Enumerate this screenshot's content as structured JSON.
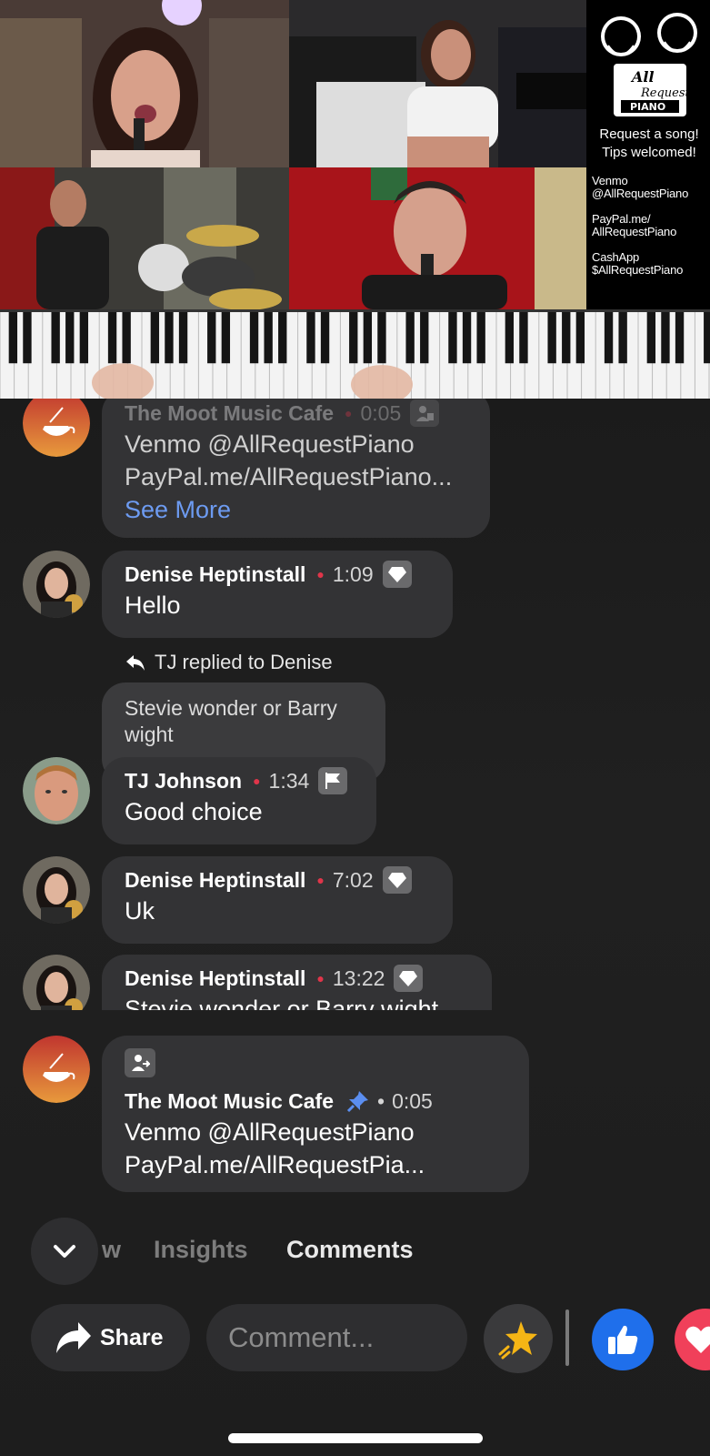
{
  "video": {
    "side_panel": {
      "logo_text": "All Request Piano",
      "line1": "Request a song!",
      "line2": "Tips welcomed!",
      "pay": [
        [
          "Venmo",
          "@AllRequestPiano"
        ],
        [
          "PayPal.me/",
          "AllRequestPiano"
        ],
        [
          "CashApp",
          "$AllRequestPiano"
        ]
      ]
    }
  },
  "comments": [
    {
      "author": "The Moot Music Cafe",
      "time": "0:05",
      "lines": [
        "Venmo @AllRequestPiano",
        "PayPal.me/AllRequestPiano..."
      ],
      "see_more": "See More",
      "badge": "moderator-icon"
    },
    {
      "author": "Denise Heptinstall",
      "time": "1:09",
      "text": "Hello",
      "badge": "diamond-icon"
    },
    {
      "reply_label": "TJ replied to Denise",
      "quoted_text_1": "Stevie wonder or Barry",
      "quoted_text_2": "wight"
    },
    {
      "author": "TJ Johnson",
      "time": "1:34",
      "text": "Good choice",
      "badge": "flag-icon"
    },
    {
      "author": "Denise Heptinstall",
      "time": "7:02",
      "text": "Uk",
      "badge": "diamond-icon"
    },
    {
      "author": "Denise Heptinstall",
      "time": "13:22",
      "text": "Stevie wonder or Barry wight",
      "badge": "diamond-icon"
    }
  ],
  "pinned": {
    "author": "The Moot Music Cafe",
    "time": "0:05",
    "line1": "Venmo @AllRequestPiano",
    "line2": "PayPal.me/AllRequestPia...",
    "icon": "pin-icon"
  },
  "tabs": {
    "partial": "w",
    "insights": "Insights",
    "comments": "Comments"
  },
  "actions": {
    "share": "Share",
    "comment_placeholder": "Comment..."
  },
  "colors": {
    "accent_blue": "#1f6feb",
    "link_blue": "#6d9bf1",
    "love_red": "#f0405a",
    "dot_red": "#e0354a"
  }
}
